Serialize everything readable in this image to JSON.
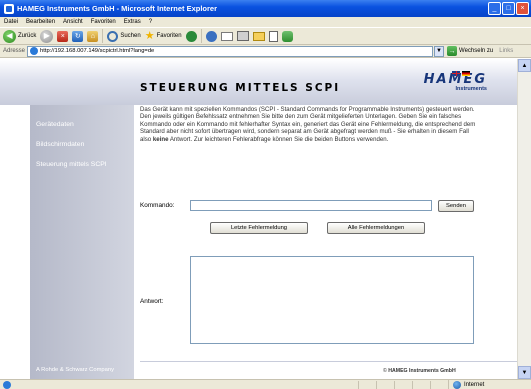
{
  "window": {
    "title": "HAMEG Instruments GmbH - Microsoft Internet Explorer",
    "controls": {
      "minimize": "_",
      "maximize": "□",
      "close": "×"
    }
  },
  "menubar": {
    "items": [
      "Datei",
      "Bearbeiten",
      "Ansicht",
      "Favoriten",
      "Extras",
      "?"
    ]
  },
  "toolbar": {
    "back_label": "Zurück",
    "search_label": "Suchen",
    "favorites_label": "Favoriten"
  },
  "addressbar": {
    "label": "Adresse",
    "url": "http://192.168.007.149/scpictrl.html?lang=de",
    "go_label": "Wechseln zu",
    "links_label": "Links"
  },
  "page": {
    "logo_main": "HAMEG",
    "logo_sub": "Instruments",
    "sidebar": {
      "items": [
        "Gerätedaten",
        "Bildschirmdaten",
        "Steuerung mittels SCPI"
      ],
      "footer": "A Rohde & Schwarz Company"
    },
    "heading": "STEUERUNG MITTELS SCPI",
    "description_part1": "Das Gerät kann mit speziellen Kommandos (SCPI - Standard Commands for Programmable Instruments) gesteuert werden. Den jeweils gültigen Befehlssatz entnehmen Sie bitte den zum Gerät mitgelieferten Unterlagen. Geben Sie ein falsches Kommando oder ein Kommando mit fehlerhafter Syntax ein, generiert das Gerät eine Fehlermeldung, die entsprechend dem Standard aber nicht sofort übertragen wird, sondern separat am Gerät abgefragt werden muß - Sie erhalten in diesem Fall also ",
    "description_bold": "keine",
    "description_part2": " Antwort. Zur leichteren Fehlerabfrage können Sie die beiden Buttons verwenden.",
    "command_label": "Kommando:",
    "command_value": "",
    "send_label": "Senden",
    "last_error_label": "Letzte Fehlermeldung",
    "all_errors_label": "Alle Fehlermeldungen",
    "answer_label": "Antwort:",
    "answer_value": "",
    "copyright_prefix": "© ",
    "copyright_company": "HAMEG Instruments GmbH"
  },
  "statusbar": {
    "zone_label": "Internet"
  },
  "icons": [
    "app-icon",
    "back-icon",
    "forward-icon",
    "stop-icon",
    "refresh-icon",
    "home-icon",
    "search-icon",
    "favorites-star-icon",
    "media-icon",
    "history-icon",
    "mail-icon",
    "print-icon",
    "folder-icon",
    "document-icon",
    "messenger-icon",
    "ie-page-icon",
    "go-arrow-icon",
    "globe-icon"
  ]
}
